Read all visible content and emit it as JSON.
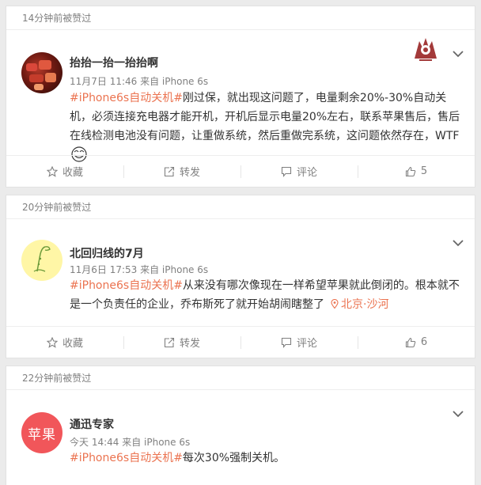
{
  "colors": {
    "accent": "#eb7350",
    "meta": "#808080",
    "text": "#333333",
    "background": "#ebebeb"
  },
  "posts": [
    {
      "liked_time": "14分钟前被赞过",
      "author": "抬抬一抬一抬抬啊",
      "time": "11月7日 11:46 来自 iPhone 6s",
      "hashtag": "#iPhone6s自动关机#",
      "text": "刚过保，就出现这问题了，电量剩余20%-30%自动关机，必须连接充电器才能开机，开机后显示电量20%左右，联系苹果售后，售后在线检测电池没有问题，让重做系统，然后重做完系统，这问题依然存在，WTF",
      "actions": {
        "collect": "收藏",
        "forward": "转发",
        "comment": "评论",
        "like": "5"
      }
    },
    {
      "liked_time": "20分钟前被赞过",
      "author": "北回归线的7月",
      "time": "11月6日 17:53 来自 iPhone 6s",
      "hashtag": "#iPhone6s自动关机#",
      "text": "从来没有哪次像现在一样希望苹果就此倒闭的。根本就不是一个负责任的企业，乔布斯死了就开始胡闹瞎整了",
      "location": "北京·沙河",
      "actions": {
        "collect": "收藏",
        "forward": "转发",
        "comment": "评论",
        "like": "6"
      }
    },
    {
      "liked_time": "22分钟前被赞过",
      "author": "通迅专家",
      "avatar_text": "苹果",
      "time": "今天 14:44 来自 iPhone 6s",
      "hashtag": "#iPhone6s自动关机#",
      "text": "每次30%强制关机。"
    }
  ]
}
